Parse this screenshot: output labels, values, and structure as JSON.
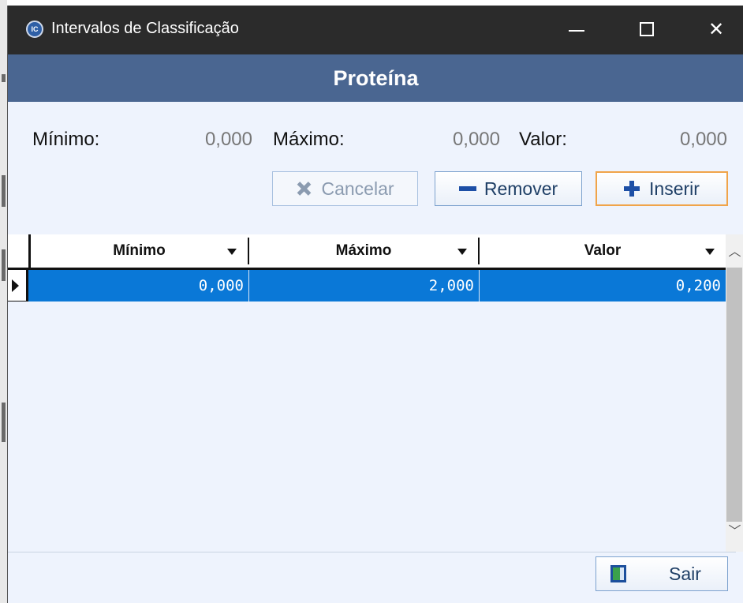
{
  "window": {
    "title": "Intervalos de Classificação",
    "app_icon_text": "IC",
    "header": "Proteína"
  },
  "fields": {
    "minimo_label": "Mínimo:",
    "minimo_value": "0,000",
    "maximo_label": "Máximo:",
    "maximo_value": "0,000",
    "valor_label": "Valor:",
    "valor_value": "0,000"
  },
  "actions": {
    "cancel_label": "Cancelar",
    "remove_label": "Remover",
    "insert_label": "Inserir",
    "exit_label": "Sair"
  },
  "grid": {
    "columns": [
      "Mínimo",
      "Máximo",
      "Valor"
    ],
    "rows": [
      [
        "0,000",
        "2,000",
        "0,200"
      ]
    ]
  },
  "colors": {
    "title_bar": "#2b2b2b",
    "header_band": "#4a6691",
    "selection": "#0a78d7",
    "focus_border": "#f0a44a"
  }
}
